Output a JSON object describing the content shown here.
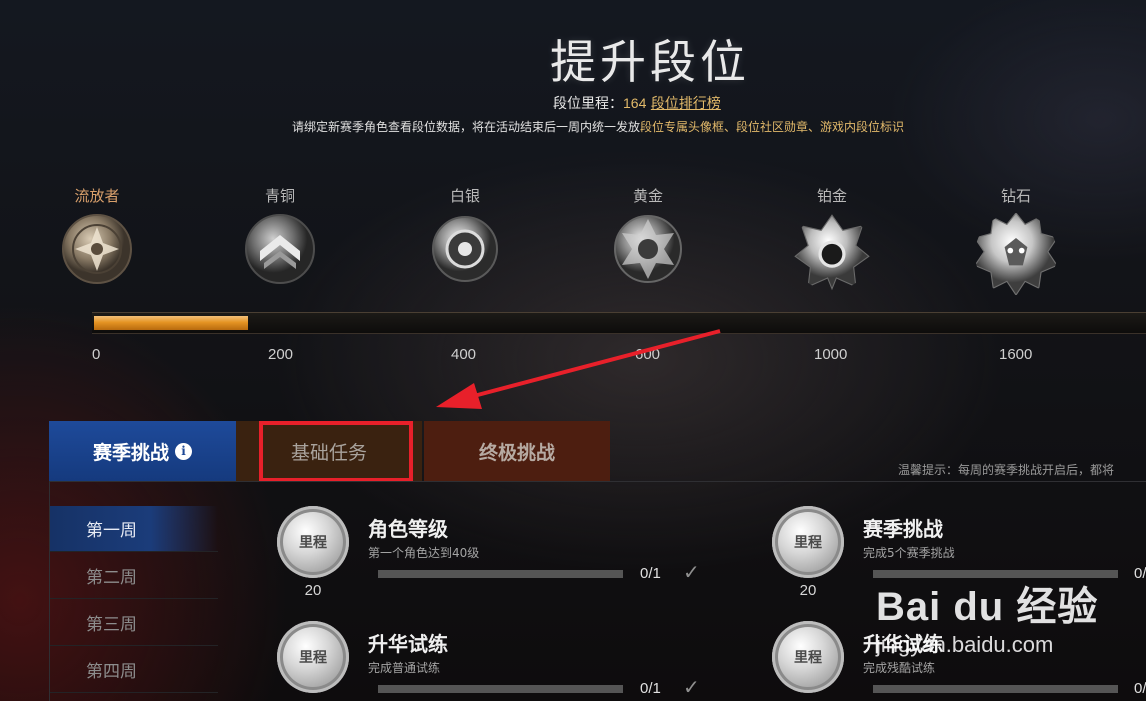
{
  "header": {
    "title": "提升段位",
    "mileage_label": "段位里程：",
    "mileage_value": "164",
    "leaderboard_link": "段位排行榜",
    "notice_prefix": "请绑定新赛季角色查看段位数据，将在活动结束后一周内统一发放",
    "notice_rewards": "段位专属头像框、段位社区勋章、游戏内段位标识"
  },
  "ranks": [
    {
      "name": "流放者",
      "icon": "exile-medal-icon"
    },
    {
      "name": "青铜",
      "icon": "bronze-medal-icon"
    },
    {
      "name": "白银",
      "icon": "silver-medal-icon"
    },
    {
      "name": "黄金",
      "icon": "gold-medal-icon"
    },
    {
      "name": "铂金",
      "icon": "platinum-medal-icon"
    },
    {
      "name": "钻石",
      "icon": "diamond-medal-icon"
    }
  ],
  "progress": {
    "ticks": [
      "0",
      "200",
      "400",
      "600",
      "1000",
      "1600"
    ],
    "current": 164
  },
  "tabs": [
    {
      "label": "赛季挑战",
      "icon": "info-icon",
      "info_glyph": "i",
      "active": true
    },
    {
      "label": "基础任务",
      "active": false
    },
    {
      "label": "终极挑战",
      "active": false
    }
  ],
  "hint": "温馨提示：每周的赛季挑战开启后，都将",
  "weeks": [
    "第一周",
    "第二周",
    "第三周",
    "第四周"
  ],
  "tasks": [
    {
      "title": "角色等级",
      "desc": "第一个角色达到40级",
      "badge": "里程",
      "reward": "20",
      "count": "0/1"
    },
    {
      "title": "赛季挑战",
      "desc": "完成5个赛季挑战",
      "badge": "里程",
      "reward": "20",
      "count": "0/"
    },
    {
      "title": "升华试练",
      "desc": "完成普通试练",
      "badge": "里程",
      "reward": "",
      "count": "0/1"
    },
    {
      "title": "升华试练",
      "desc": "完成残酷试练",
      "badge": "里程",
      "reward": "",
      "count": "0/"
    }
  ],
  "watermark": {
    "brand": "Bai du 经验",
    "url": "jingyan.baidu.com"
  },
  "colors": {
    "accent_gold": "#e2b96a",
    "progress_orange": "#e59423",
    "tab_blue": "#1e4a9a",
    "annotation_red": "#e8202a"
  }
}
